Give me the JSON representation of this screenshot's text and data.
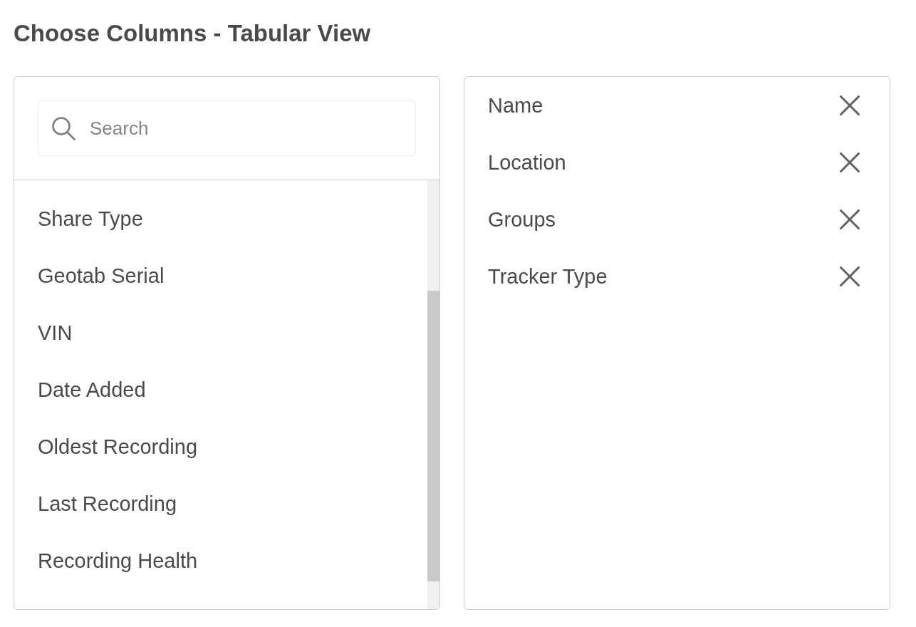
{
  "title": "Choose Columns - Tabular View",
  "available_columns": {
    "search": {
      "placeholder": "Search"
    },
    "items": [
      "Share Type",
      "Geotab Serial",
      "VIN",
      "Date Added",
      "Oldest Recording",
      "Last Recording",
      "Recording Health"
    ]
  },
  "selected_columns": [
    "Name",
    "Location",
    "Groups",
    "Tracker Type"
  ]
}
